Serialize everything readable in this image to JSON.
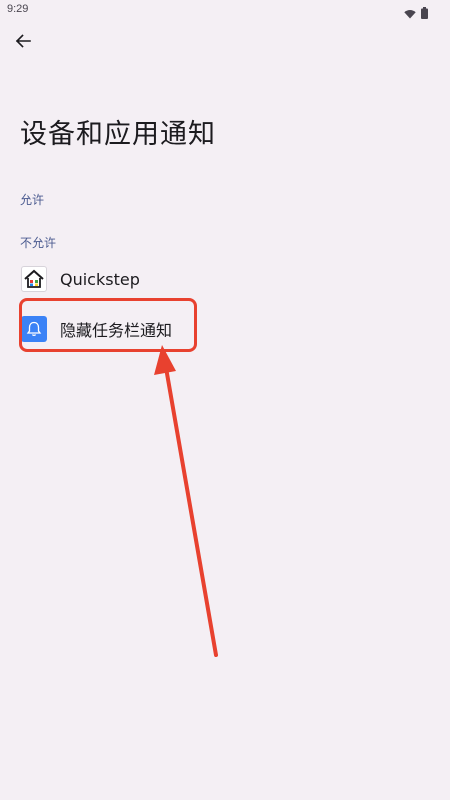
{
  "status_bar": {
    "time": "9:29",
    "icons": [
      "wifi-icon",
      "battery-icon"
    ]
  },
  "header": {
    "back_icon": "arrow-left-icon",
    "title": "设备和应用通知"
  },
  "sections": {
    "allowed_header": "允许",
    "not_allowed_header": "不允许"
  },
  "apps": [
    {
      "label": "Quickstep",
      "icon": "home-icon"
    },
    {
      "label": "隐藏任务栏通知",
      "icon": "bell-icon"
    }
  ],
  "annotation": {
    "color": "#e8412f",
    "highlighted_item": "隐藏任务栏通知"
  },
  "colors": {
    "background": "#f4eff4",
    "section_header": "#4a5a8f",
    "bell_app_bg": "#3b82f6",
    "annotation": "#e8412f"
  }
}
